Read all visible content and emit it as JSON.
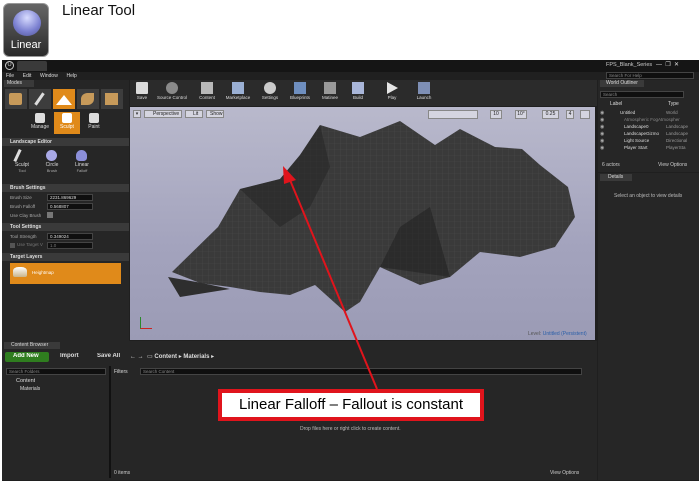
{
  "header": {
    "icon_label": "Linear",
    "title": "Linear Tool"
  },
  "window": {
    "project": "FPS_Blank_Series",
    "search_help": "Search For Help"
  },
  "menu": [
    "File",
    "Edit",
    "Window",
    "Help"
  ],
  "modes": {
    "title": "Modes",
    "tabs": [
      "Manage",
      "Sculpt",
      "Paint"
    ]
  },
  "toolbar": [
    "Save",
    "Source Control",
    "Content",
    "Marketplace",
    "Settings",
    "Blueprints",
    "Matinee",
    "Build",
    "Play",
    "Launch"
  ],
  "landscape": {
    "title": "Landscape Editor",
    "tools": [
      {
        "label": "Sculpt",
        "sub": "Tool"
      },
      {
        "label": "Circle",
        "sub": "Brush"
      },
      {
        "label": "Linear",
        "sub": "Falloff"
      }
    ],
    "brush_settings": "Brush Settings",
    "brush_size_label": "Brush Size",
    "brush_size": "2231.869629",
    "brush_falloff_label": "Brush Falloff",
    "brush_falloff": "0.568807",
    "clay_label": "Use Clay Brush",
    "tool_settings": "Tool Settings",
    "tool_strength_label": "Tool Strength",
    "tool_strength": "0.349024",
    "target_label": "Use Target V",
    "target_value": "1.0",
    "target_layers": "Target Layers",
    "heightmap": "Heightmap"
  },
  "viewport": {
    "perspective": "Perspective",
    "lit": "Lit",
    "show": "Show",
    "grid": "10",
    "angle": "10°",
    "scale": "0.25",
    "cam": "4",
    "level_label": "Level:",
    "level": "Untitled (Persistent)"
  },
  "outliner": {
    "title": "World Outliner",
    "search": "Search",
    "col_label": "Label",
    "col_type": "Type",
    "rows": [
      {
        "label": "Untitled",
        "type": "World"
      },
      {
        "label": "Atmospheric FogAtmospher",
        "type": ""
      },
      {
        "label": "Landscape0",
        "type": "Landscape"
      },
      {
        "label": "LandscapeGizmo",
        "type": "Landscape"
      },
      {
        "label": "Light Source",
        "type": "Directional"
      },
      {
        "label": "Player Start",
        "type": "PlayerSta"
      }
    ],
    "actors": "6 actors",
    "view_options": "View Options"
  },
  "details": {
    "title": "Details",
    "empty": "Select an object to view details"
  },
  "content_browser": {
    "tab": "Content Browser",
    "add_new": "Add New",
    "import": "Import",
    "save_all": "Save All",
    "path_root": "Content",
    "path_leaf": "Materials",
    "search_folders": "Search Folders",
    "folder_root": "Content",
    "folder_child": "Materials",
    "filters": "Filters",
    "search_content": "Search Content",
    "drop_hint": "Drop files here or right click to create content.",
    "items": "0 items",
    "view_options": "View Options"
  },
  "callout": "Linear Falloff – Fallout is constant",
  "colors": {
    "accent": "#e08a1a",
    "callout_red": "#e0141c",
    "viewport": "#aeb0c7"
  }
}
